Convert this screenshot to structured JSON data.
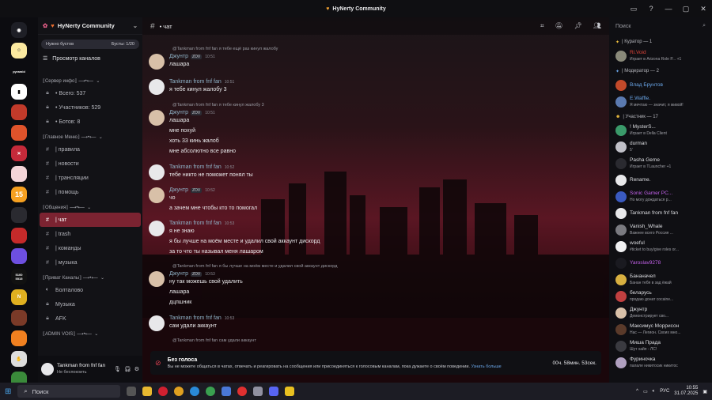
{
  "window": {
    "title": "HyNerty Community"
  },
  "servers": {
    "label_2": "pyramid",
    "label_6": "15",
    "label_10": "5100\n5515"
  },
  "sidebar": {
    "server_name": "HyNerty Community",
    "boost_left": "Нужно бустов",
    "boost_right": "Бусты: 1/20",
    "browse_label": "Просмотр каналов",
    "categories": [
      {
        "label": "⟦Сервер инфо⟧ ⟶•⟵",
        "channels": [
          {
            "icon": "lock",
            "label": "• Всего: 537"
          },
          {
            "icon": "lock",
            "label": "• Участников: 529"
          },
          {
            "icon": "lock",
            "label": "• Ботов: 8"
          }
        ]
      },
      {
        "label": "⟦Главное Меню⟧ ⟶•⟵",
        "channels": [
          {
            "icon": "hash",
            "label": "| правила"
          },
          {
            "icon": "hash",
            "label": "| новости"
          },
          {
            "icon": "hash",
            "label": "| трансляции"
          },
          {
            "icon": "hash",
            "label": "| помощь"
          }
        ]
      },
      {
        "label": "⟦Общения⟧ ⟶•⟵",
        "channels": [
          {
            "icon": "hash",
            "label": "| чат",
            "active": true
          },
          {
            "icon": "hash",
            "label": "| trash"
          },
          {
            "icon": "hash",
            "label": "| команды"
          },
          {
            "icon": "hash",
            "label": "| музыка"
          }
        ]
      },
      {
        "label": "⟦Приват Каналы⟧ ⟶•⟵",
        "channels": [
          {
            "icon": "speaker",
            "label": "Болталово"
          },
          {
            "icon": "lock",
            "label": "Музыка"
          },
          {
            "icon": "lock",
            "label": "AFK"
          }
        ]
      },
      {
        "label": "⟦ADMIN VOIS⟧ ⟶•⟵",
        "channels": []
      }
    ]
  },
  "user": {
    "name": "Tankman from fnf fan",
    "status": "Не беспокоить"
  },
  "chat": {
    "channel": "• чат",
    "messages": [
      {
        "reply": "@Tankman from fnf fan я тебе ещё раз кинул жалобу",
        "author": "Джунтр",
        "tag": "ZOV",
        "time": "10:51",
        "lines": [
          "лашара"
        ]
      },
      {
        "reply": "",
        "author": "Tankman from fnf fan",
        "tag": "",
        "time": "10:51",
        "lines": [
          "я тебе кинул жалобу 3"
        ]
      },
      {
        "reply": "@Tankman from fnf fan я тебе кинул жалобу 3",
        "author": "Джунтр",
        "tag": "ZOV",
        "time": "10:51",
        "lines": [
          "лашара",
          "мне похуй",
          "хоть 33 кинь жалоб",
          "мне абсолютно все равно"
        ]
      },
      {
        "reply": "",
        "author": "Tankman from fnf fan",
        "tag": "",
        "time": "10:52",
        "lines": [
          "тебе никто не поможет понял ты"
        ]
      },
      {
        "reply": "",
        "author": "Джунтр",
        "tag": "ZOV",
        "time": "10:52",
        "lines": [
          "чо",
          "а зачем мне чтобы кто то помогал"
        ]
      },
      {
        "reply": "",
        "author": "Tankman from fnf fan",
        "tag": "",
        "time": "10:53",
        "lines": [
          "я не знаю",
          "я бы лучше на моём месте и удалил свой аккаунт дискорд",
          "за то что ты называл меня лашаром"
        ]
      },
      {
        "reply": "@Tankman from fnf fan я бы лучше на моём месте и удалил свой аккаунт дискорд",
        "author": "Джунтр",
        "tag": "ZOV",
        "time": "10:53",
        "lines": [
          "ну так можешь свой удалить",
          "лашара",
          "дцпшник"
        ]
      },
      {
        "reply": "",
        "author": "Tankman from fnf fan",
        "tag": "",
        "time": "10:53",
        "lines": [
          "сам удали аккаунт"
        ]
      },
      {
        "reply": "@Tankman from fnf fan сам удали аккаунт",
        "author": "",
        "tag": "",
        "time": "",
        "lines": []
      }
    ],
    "banner": {
      "title": "Без голоса",
      "text": "Вы не можете общаться в чатах, отвечать и реагировать на сообщения или присоединяться к голосовым каналам, пока дужаете о своём поведении.",
      "link": "Узнать больше",
      "timer": "00ч. 58мин. 53сек."
    }
  },
  "members": {
    "search_placeholder": "Поиск",
    "groups": [
      {
        "label": "| Куратор — 1",
        "items": [
          {
            "name": "Ri.Void",
            "badge": "AZ15",
            "status": "Играет в Arizona Role P... +1",
            "color": "#e0453a"
          }
        ]
      },
      {
        "label": "| Модератор — 2",
        "items": [
          {
            "name": "Влад Брунтов",
            "badge": "SURV",
            "status": "",
            "color": "#6aa6e8"
          },
          {
            "name": "E.Waffle.",
            "badge": "TES",
            "status": "Я мечтаю — значит, я живой!",
            "color": "#6aa6e8"
          }
        ]
      },
      {
        "label": "| Участник — 17",
        "items": [
          {
            "name": "! MysterS...",
            "badge": "STAR",
            "status": "Играет в Della Client",
            "color": "#dcdde1"
          },
          {
            "name": "durman",
            "badge": "413",
            "status": "5'",
            "color": "#dcdde1"
          },
          {
            "name": "Pasha Geme",
            "badge": "",
            "status": "Играет в TLauncher +1",
            "color": "#dcdde1"
          },
          {
            "name": "Rename.",
            "badge": "girlz",
            "status": "",
            "color": "#dcdde1"
          },
          {
            "name": "Sonic Gamer PC...",
            "badge": "SR",
            "status": "Но могу дождаться р...",
            "color": "#c160e8"
          },
          {
            "name": "Tankman from fnf fan",
            "badge": "",
            "status": "",
            "color": "#dcdde1"
          },
          {
            "name": "Vanish_Whale",
            "badge": "",
            "status": "Важнее всего Россия ...",
            "color": "#dcdde1"
          },
          {
            "name": "woeful",
            "badge": "",
            "status": "#ticket to buy/give roles or...",
            "color": "#dcdde1"
          },
          {
            "name": "Yaroslav9278",
            "badge": "",
            "status": "",
            "color": "#c160e8"
          },
          {
            "name": "Бананачел",
            "badge": "",
            "status": "Банан тебя в зад ёжай",
            "color": "#dcdde1"
          },
          {
            "name": "беларусь",
            "badge": "Chin",
            "status": "продаю донат cocaine...",
            "color": "#dcdde1"
          },
          {
            "name": "Джунтр",
            "badge": "ZOV",
            "status": "Демонстрирует сво...",
            "color": "#dcdde1"
          },
          {
            "name": "Максимус Моррисон",
            "badge": "",
            "status": "Нас — Легион. Своих мно...",
            "color": "#dcdde1"
          },
          {
            "name": "Миша Прада",
            "badge": "PTS",
            "status": "Шут хайп - ЛС!",
            "color": "#dcdde1"
          },
          {
            "name": "Фуриночка",
            "badge": "",
            "status": "палале никитосик никитос",
            "color": "#dcdde1"
          }
        ]
      }
    ]
  },
  "taskbar": {
    "search": "Поиск",
    "lang": "РУС",
    "time": "10:55",
    "date": "31.07.2025"
  }
}
